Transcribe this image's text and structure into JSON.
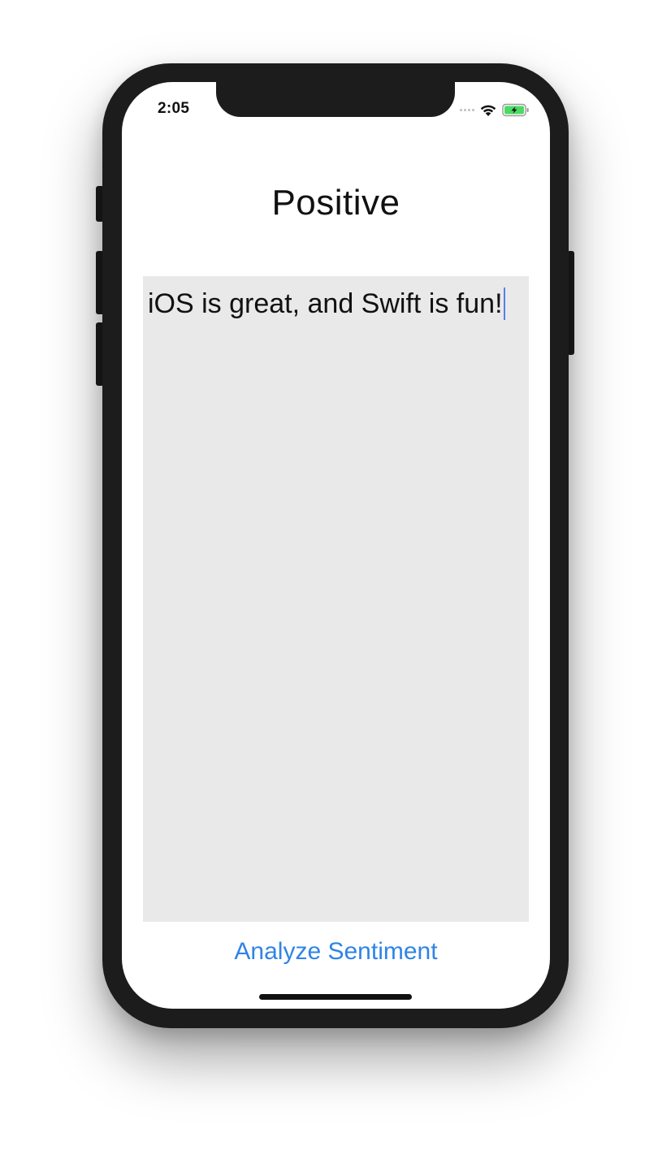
{
  "status_bar": {
    "time": "2:05",
    "icons": [
      "cellular-signal-icon",
      "wifi-icon",
      "battery-charging-icon"
    ],
    "battery_color": "#4cd964"
  },
  "main": {
    "sentiment_label": "Positive",
    "input_text": "iOS is great, and Swift is fun!",
    "analyze_button_label": "Analyze Sentiment"
  },
  "colors": {
    "accent": "#2f84e5",
    "text_area_background": "#e9e9e9",
    "caret": "#5a7ee8"
  }
}
